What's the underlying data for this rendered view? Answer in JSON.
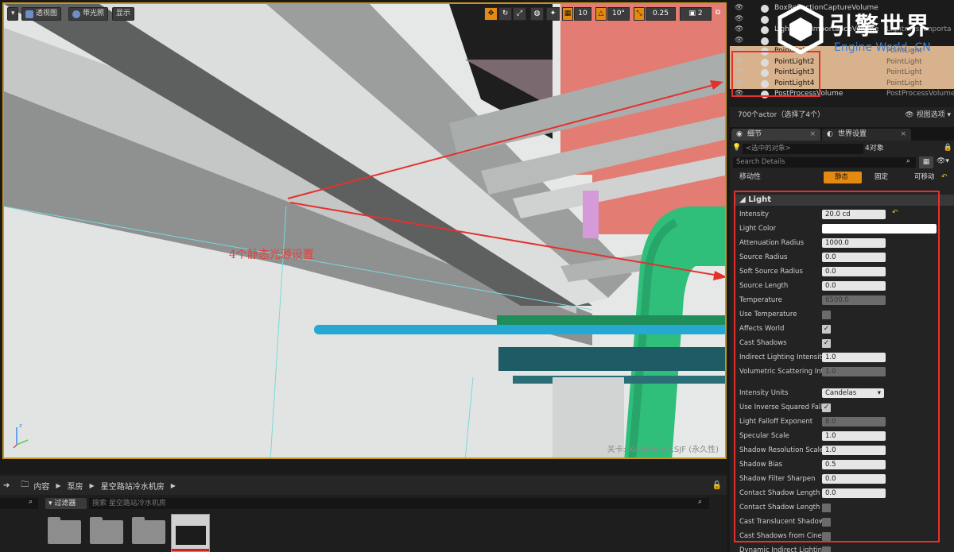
{
  "viewport": {
    "toolbar": {
      "perspective": "透视图",
      "lit": "带光照",
      "show": "显示",
      "grid_snap": "10",
      "rotate_snap": "10°",
      "scale_snap": "0.25",
      "camera_speed": "2"
    },
    "annotation": "4个静态光源设置",
    "level_label": "关卡: XingKong_LSJF (永久性)"
  },
  "content_browser": {
    "breadcrumb": [
      "内容",
      "泵房",
      "星空路站冷水机房"
    ],
    "filter_label": "过滤器",
    "search_placeholder": "搜索 星空路站冷水机房"
  },
  "outliner": {
    "rows": [
      {
        "name": "BoxReflectionCaptureVolume",
        "type": "",
        "selected": false
      },
      {
        "name": "",
        "type": "",
        "selected": false
      },
      {
        "name": "LightmassImportanceVolume",
        "type": "LightmassImporta",
        "selected": false
      },
      {
        "name": "",
        "type": "",
        "selected": false
      },
      {
        "name": "PointLight",
        "type": "PointLight",
        "selected": true
      },
      {
        "name": "PointLight2",
        "type": "PointLight",
        "selected": true
      },
      {
        "name": "PointLight3",
        "type": "PointLight",
        "selected": true
      },
      {
        "name": "PointLight4",
        "type": "PointLight",
        "selected": true
      },
      {
        "name": "PostProcessVolume",
        "type": "PostProcessVolume",
        "selected": false
      }
    ],
    "count": "700个actor（选择了4个）",
    "view_options": "视图选项"
  },
  "details": {
    "tab_details": "细节",
    "tab_world": "世界设置",
    "selected_placeholder": "<选中的对象>",
    "selected_count": "4对象",
    "search_placeholder": "Search Details",
    "mobility_label": "移动性",
    "mobility_static": "静态",
    "mobility_stationary": "固定",
    "mobility_movable": "可移动",
    "section": "Light",
    "props": [
      {
        "label": "Intensity",
        "value": "20.0 cd",
        "kind": "text",
        "reset": true
      },
      {
        "label": "Light Color",
        "value": "",
        "kind": "color"
      },
      {
        "label": "Attenuation Radius",
        "value": "1000.0",
        "kind": "text"
      },
      {
        "label": "Source Radius",
        "value": "0.0",
        "kind": "text"
      },
      {
        "label": "Soft Source Radius",
        "value": "0.0",
        "kind": "text"
      },
      {
        "label": "Source Length",
        "value": "0.0",
        "kind": "text"
      },
      {
        "label": "Temperature",
        "value": "6500.0",
        "kind": "disabled"
      },
      {
        "label": "Use Temperature",
        "value": "",
        "kind": "check-off"
      },
      {
        "label": "Affects World",
        "value": "",
        "kind": "check-on"
      },
      {
        "label": "Cast Shadows",
        "value": "",
        "kind": "check-on"
      },
      {
        "label": "Indirect Lighting Intensity",
        "value": "1.0",
        "kind": "text"
      },
      {
        "label": "Volumetric Scattering Intensity",
        "value": "1.0",
        "kind": "disabled"
      },
      {
        "label": "Intensity Units",
        "value": "Candelas",
        "kind": "select"
      },
      {
        "label": "Use Inverse Squared Falloff",
        "value": "",
        "kind": "check-on"
      },
      {
        "label": "Light Falloff Exponent",
        "value": "8.0",
        "kind": "disabled"
      },
      {
        "label": "Specular Scale",
        "value": "1.0",
        "kind": "text"
      },
      {
        "label": "Shadow Resolution Scale",
        "value": "1.0",
        "kind": "text"
      },
      {
        "label": "Shadow Bias",
        "value": "0.5",
        "kind": "text"
      },
      {
        "label": "Shadow Filter Sharpen",
        "value": "0.0",
        "kind": "text"
      },
      {
        "label": "Contact Shadow Length",
        "value": "0.0",
        "kind": "text"
      },
      {
        "label": "Contact Shadow Length In World Space Units",
        "value": "",
        "kind": "check-off"
      },
      {
        "label": "Cast Translucent Shadows",
        "value": "",
        "kind": "check-off"
      },
      {
        "label": "Cast Shadows from Cinematic Objects Only",
        "value": "",
        "kind": "check-off"
      },
      {
        "label": "Dynamic Indirect Lighting",
        "value": "",
        "kind": "check-off"
      }
    ]
  },
  "watermark": {
    "title": "引擎世界",
    "subtitle": "Engine World .CN"
  },
  "colors": {
    "selection_bg": "#d8b28c",
    "highlight_red": "#e4312e",
    "active_orange": "#e48a10"
  }
}
